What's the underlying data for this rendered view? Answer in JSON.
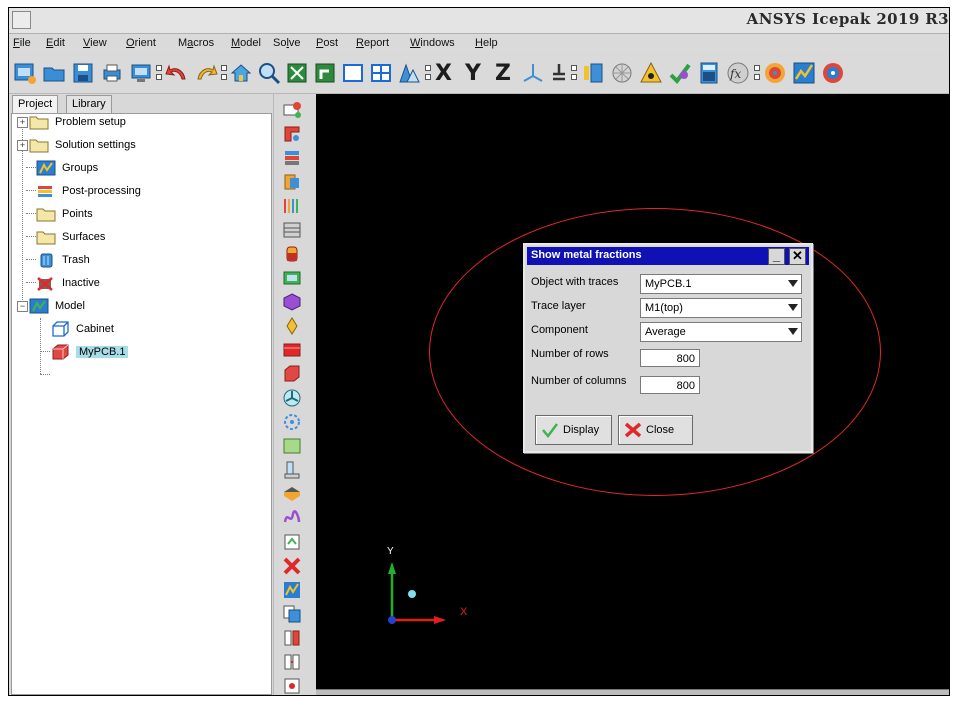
{
  "window": {
    "title": "ANSYS Icepak 2019 R3"
  },
  "menu": [
    {
      "pre": "",
      "ul": "F",
      "post": "ile"
    },
    {
      "pre": "",
      "ul": "E",
      "post": "dit"
    },
    {
      "pre": "",
      "ul": "V",
      "post": "iew"
    },
    {
      "pre": "",
      "ul": "O",
      "post": "rient"
    },
    {
      "pre": "M",
      "ul": "a",
      "post": "cros"
    },
    {
      "pre": "",
      "ul": "M",
      "post": "odel"
    },
    {
      "pre": "So",
      "ul": "l",
      "post": "ve"
    },
    {
      "pre": "",
      "ul": "P",
      "post": "ost"
    },
    {
      "pre": "",
      "ul": "R",
      "post": "eport"
    },
    {
      "pre": "",
      "ul": "W",
      "post": "indows"
    },
    {
      "pre": "",
      "ul": "H",
      "post": "elp"
    }
  ],
  "toolbar": {
    "axis_x": "X",
    "axis_y": "Y",
    "axis_z": "Z"
  },
  "tabs": {
    "project": "Project",
    "library": "Library"
  },
  "tree": {
    "problem_setup": "Problem setup",
    "solution_settings": "Solution settings",
    "groups": "Groups",
    "post_processing": "Post-processing",
    "points": "Points",
    "surfaces": "Surfaces",
    "trash": "Trash",
    "inactive": "Inactive",
    "model": "Model",
    "cabinet": "Cabinet",
    "mypcb": "MyPCB.1"
  },
  "dialog": {
    "title": "Show metal fractions",
    "object_label": "Object with traces",
    "object_value": "MyPCB.1",
    "layer_label": "Trace layer",
    "layer_value": "M1(top)",
    "component_label": "Component",
    "component_value": "Average",
    "rows_label": "Number of rows",
    "rows_value": "800",
    "cols_label": "Number of columns",
    "cols_value": "800",
    "display_label": "Display",
    "close_label": "Close"
  },
  "triad": {
    "y": "Y",
    "x": "X"
  },
  "colors": {
    "dialog_title_bar": "#1010b4",
    "highlight_ellipse": "#e0282a",
    "viewport": "#000000",
    "selected_node": "#a8dde8"
  }
}
